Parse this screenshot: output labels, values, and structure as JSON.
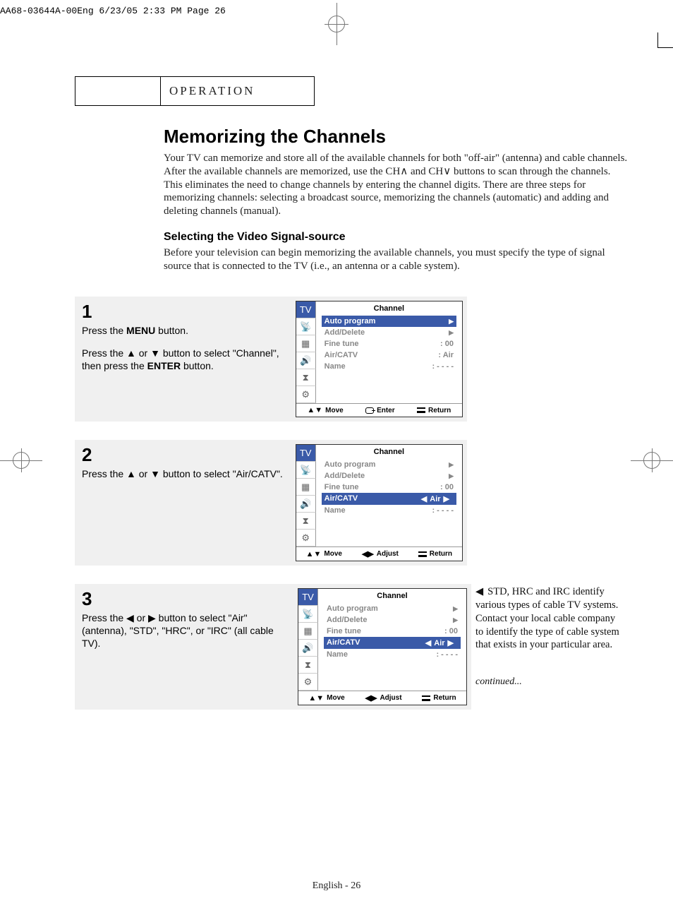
{
  "print_header": "AA68-03644A-00Eng  6/23/05  2:33 PM  Page 26",
  "section_label": "OPERATION",
  "title": "Memorizing the Channels",
  "intro": "Your TV can memorize and store all of the available channels for both \"off-air\" (antenna) and cable channels. After the available channels are memorized, use the CH∧ and CH∨ buttons to scan through the channels. This eliminates the need to change channels by entering the channel digits. There are three steps for memorizing channels: selecting a broadcast source, memorizing the channels (automatic) and adding and deleting channels (manual).",
  "subhead": "Selecting the Video Signal-source",
  "subintro": "Before your television can begin memorizing the available channels, you must specify the type of signal source that is connected to the TV (i.e., an antenna or a cable system).",
  "steps": [
    {
      "num": "1",
      "lines": [
        "Press the MENU button.",
        "",
        "Press the ▲ or ▼ button to select \"Channel\", then press the ENTER button."
      ],
      "osd": {
        "title": "Channel",
        "rows": [
          {
            "label": "Auto program",
            "val": "",
            "sel": true,
            "arrow": true
          },
          {
            "label": "Add/Delete",
            "val": "",
            "arrow": true
          },
          {
            "label": "Fine tune",
            "val": ":   00"
          },
          {
            "label": "Air/CATV",
            "val": ":   Air"
          },
          {
            "label": "Name",
            "val": ":   - - - -"
          }
        ],
        "footer": [
          "Move",
          "Enter",
          "Return"
        ],
        "footer_style": "enter"
      }
    },
    {
      "num": "2",
      "lines": [
        "Press the ▲ or ▼ button to select \"Air/CATV\"."
      ],
      "osd": {
        "title": "Channel",
        "rows": [
          {
            "label": "Auto program",
            "val": "",
            "arrow": true
          },
          {
            "label": "Add/Delete",
            "val": "",
            "arrow": true
          },
          {
            "label": "Fine tune",
            "val": ":   00"
          },
          {
            "label": "Air/CATV",
            "val": "Air",
            "sel": true,
            "pill": true
          },
          {
            "label": "Name",
            "val": ":   - - - -"
          }
        ],
        "footer": [
          "Move",
          "Adjust",
          "Return"
        ],
        "footer_style": "adjust"
      }
    },
    {
      "num": "3",
      "lines": [
        "Press the ◀ or ▶ button to select \"Air\" (antenna), \"STD\", \"HRC\", or \"IRC\" (all cable TV)."
      ],
      "osd": {
        "title": "Channel",
        "rows": [
          {
            "label": "Auto program",
            "val": "",
            "arrow": true
          },
          {
            "label": "Add/Delete",
            "val": "",
            "arrow": true
          },
          {
            "label": "Fine tune",
            "val": ":   00"
          },
          {
            "label": "Air/CATV",
            "val": "Air",
            "sel": true,
            "pill": true
          },
          {
            "label": "Name",
            "val": ":   - - - -"
          }
        ],
        "footer": [
          "Move",
          "Adjust",
          "Return"
        ],
        "footer_style": "adjust"
      }
    }
  ],
  "sidenote": "STD, HRC and IRC  identify various types of cable TV systems. Contact your local cable company to identify the type of cable system that exists in your particular area.",
  "continued": "continued...",
  "page_footer": "English - 26",
  "icons": [
    "TV",
    "ant",
    "pic",
    "snd",
    "set",
    "slide"
  ]
}
